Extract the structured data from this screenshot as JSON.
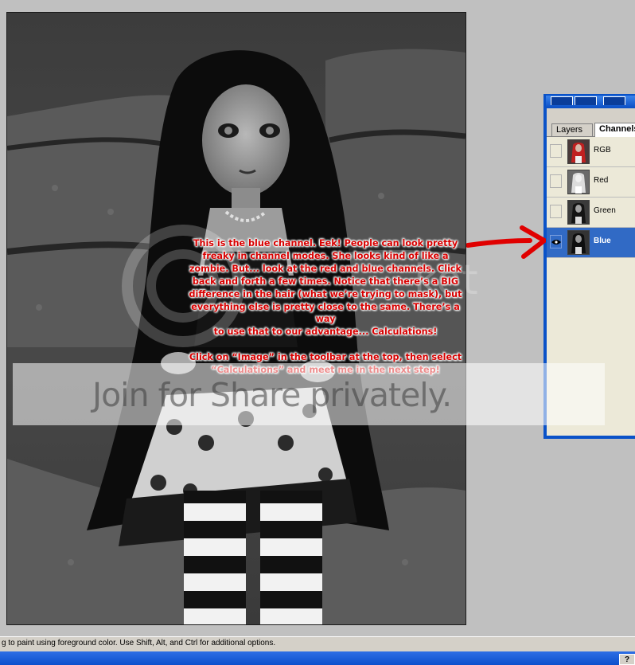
{
  "canvas": {
    "tutorial_text": "This is the blue channel. Eek!  People can look pretty\nfreaky in channel modes.  She looks kind of like a\nzombie.  But... look at the red and blue channels.  Click\nback and forth a few times.  Notice that there’s a BIG\ndifference in the hair (what we’re trying to mask), but\neverything else is pretty close to the same.  There’s a way\nto use that to our advantage... Calculations!\n\nClick on “Image” in the toolbar at the top, then select\n“Calculations” and meet me in the next step!",
    "watermark": {
      "banner_text": "Join for Share privately.",
      "logo_text": "ket"
    }
  },
  "palette": {
    "tabs": [
      {
        "label": "Layers",
        "active": false
      },
      {
        "label": "Channels",
        "active": true
      }
    ],
    "channels": [
      {
        "name": "RGB",
        "visible": false,
        "selected": false,
        "thumb": "rgb"
      },
      {
        "name": "Red",
        "visible": false,
        "selected": false,
        "thumb": "red"
      },
      {
        "name": "Green",
        "visible": false,
        "selected": false,
        "thumb": "green"
      },
      {
        "name": "Blue",
        "visible": true,
        "selected": true,
        "thumb": "blue"
      }
    ]
  },
  "status_bar": {
    "text": "g to paint using foreground color.  Use Shift, Alt, and Ctrl for additional options."
  },
  "taskbar": {
    "help_label": "?"
  },
  "colors": {
    "annotation_red": "#d80000",
    "selection_blue": "#316ac5",
    "window_blue": "#0a52c8"
  }
}
